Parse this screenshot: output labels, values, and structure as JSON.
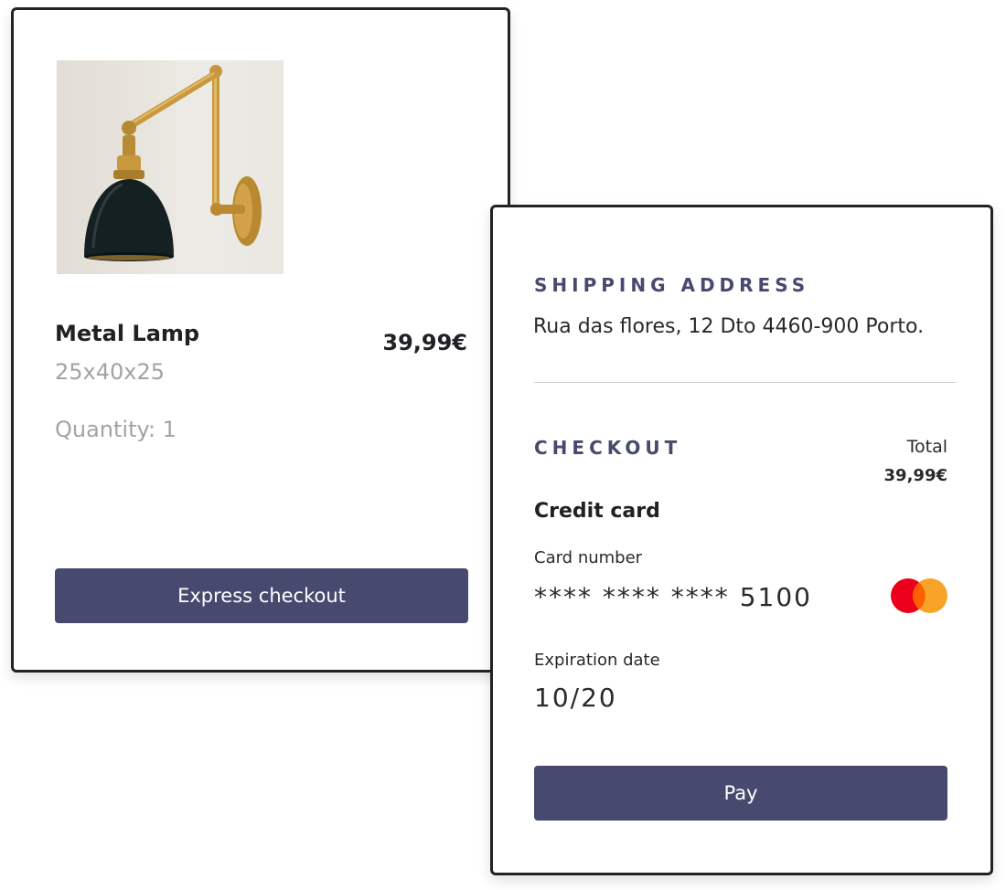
{
  "product": {
    "name": "Metal Lamp",
    "dimensions": "25x40x25",
    "price": "39,99€",
    "quantity": "Quantity: 1",
    "express_checkout_label": "Express checkout"
  },
  "shipping": {
    "title": "SHIPPING ADDRESS",
    "address": "Rua das flores, 12 Dto 4460-900 Porto."
  },
  "checkout": {
    "title": "CHECKOUT",
    "total_label": "Total",
    "total_value": "39,99€",
    "payment_method": "Credit card",
    "card_number_label": "Card number",
    "card_number": "**** **** **** 5100",
    "card_logo": "mastercard-icon",
    "expiration_label": "Expiration date",
    "expiration_value": "10/20",
    "pay_label": "Pay"
  },
  "colors": {
    "accent": "#474a6e",
    "border": "#222327",
    "muted_text": "#a3a3a3",
    "mastercard_red": "#eb001b",
    "mastercard_orange": "#f79e1b"
  }
}
